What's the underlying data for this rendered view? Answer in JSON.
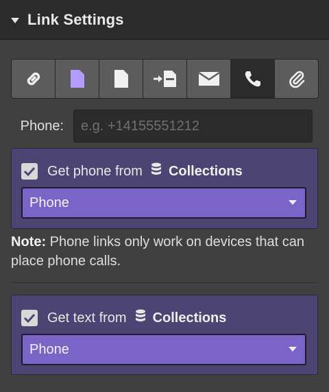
{
  "header": {
    "title": "Link Settings"
  },
  "tabs": [
    {
      "icon": "link-icon",
      "active": false
    },
    {
      "icon": "page-purple-icon",
      "active": false
    },
    {
      "icon": "page-icon",
      "active": false
    },
    {
      "icon": "section-anchor-icon",
      "active": false
    },
    {
      "icon": "email-icon",
      "active": false
    },
    {
      "icon": "phone-icon",
      "active": true
    },
    {
      "icon": "attachment-icon",
      "active": false
    }
  ],
  "phone": {
    "label": "Phone:",
    "placeholder": "e.g. +14155551212",
    "value": ""
  },
  "phone_source": {
    "checked": true,
    "label": "Get phone from",
    "collections": "Collections",
    "selected": "Phone"
  },
  "note": {
    "bold": "Note:",
    "text": " Phone links only work on devices that can place phone calls."
  },
  "text_source": {
    "checked": true,
    "label": "Get text from",
    "collections": "Collections",
    "selected": "Phone"
  },
  "colors": {
    "panel": "#4c4473",
    "select": "#7b64c8",
    "accent": "#b39cff"
  }
}
